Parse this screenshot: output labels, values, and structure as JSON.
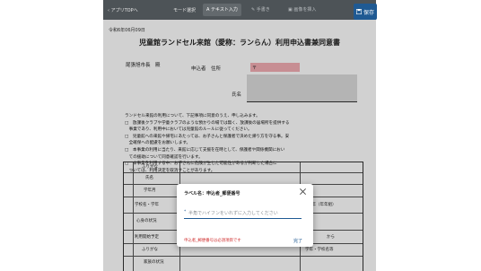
{
  "toolbar": {
    "back_label": "アプリTOPへ",
    "mode_label": "モード選択",
    "tools": [
      {
        "label": "テキスト入力",
        "active": true
      },
      {
        "label": "手書き",
        "active": false
      },
      {
        "label": "画像を挿入",
        "active": false
      }
    ],
    "save_label": "保存"
  },
  "document": {
    "date": "令和6年06月09日",
    "title": "児童館ランドセル来館（愛称：ランらん）利用申込書兼同意書",
    "addressee": "尾張旭市長　殿",
    "applicant_label": "申込者　住所",
    "applicant_field_mark": "〒",
    "name_label": "氏名",
    "body_lines": [
      "ランドセル来館の利用について、下記事項に同意のうえ、申し込みます。",
      "□　放課後クラブや学童クラブのような預かりの場では無く、放課後の居場所を提供する",
      "　事業であり、利用中においては児童館のルールに従ってください。",
      "□　児童館への来館や帰宅にあたっては、お子さんと保護者で決めた帰り方を守る事。安",
      "　全確保への配慮をお願いします。",
      "□　本事業の利用に当たり、来館に応じて支援を在時として、保護者や関係機関におい",
      "　ての援助について同意確認を行います。",
      "□　本事業を利用する中、お子さんに危険が生じた可能性があるが判断した場合に",
      "　ついては、利用決定を取消すことがあります。"
    ],
    "table": {
      "furigana": "ふりがな",
      "name": "氏名",
      "grade": "学年月",
      "school": "学校名・学年",
      "school_hint": "学年（年年組）",
      "mind": "心身の状況",
      "usage_start": "利用開始予定",
      "kara": "から",
      "furigana2": "ふりがな",
      "school2": "学年・学校名等",
      "family": "家族の状況"
    }
  },
  "modal": {
    "title": "ラベル名：申込者_郵便番号",
    "required_mark": "*",
    "placeholder": "半角でハイフンをいれずに入力してください",
    "error": "申込者_郵便番号は必須項目です",
    "done_label": "完了"
  },
  "colors": {
    "toolbar": "#4d5357",
    "save": "#1f5a93",
    "accent": "#1f5a93",
    "error": "#d03030",
    "highlight_field": "#f3aeb4"
  }
}
